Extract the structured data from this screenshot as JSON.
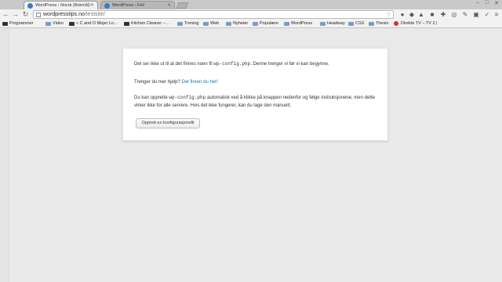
{
  "tabs": [
    {
      "title": "WordPress › Norsk (Bokmål)",
      "active": true
    },
    {
      "title": "WordPress › Feil",
      "active": false
    }
  ],
  "toolbar": {
    "url_host": "wordpresstips.no",
    "url_path": "/testsite/"
  },
  "bookmarks": [
    {
      "label": "Programmer",
      "icon": "apps-icon"
    },
    {
      "label": "Video",
      "icon": "folder-icon"
    },
    {
      "label": "« C and O Mojer Lo…",
      "icon": "page-icon"
    },
    {
      "label": "Kitchen Cleaner –…",
      "icon": "page-icon"
    },
    {
      "label": "Trening",
      "icon": "folder-icon"
    },
    {
      "label": "Web",
      "icon": "folder-icon"
    },
    {
      "label": "Nyheter",
      "icon": "folder-icon"
    },
    {
      "label": "Populære",
      "icon": "folder-icon"
    },
    {
      "label": "WordPress",
      "icon": "folder-icon"
    },
    {
      "label": "Headway",
      "icon": "folder-icon"
    },
    {
      "label": "CSS",
      "icon": "folder-icon"
    },
    {
      "label": "Thesis",
      "icon": "folder-icon"
    },
    {
      "label": "Direkte TV – TV 2 |",
      "icon": "tv2-icon"
    }
  ],
  "content": {
    "p1_before": "Det ser ikke ut til at det finnes noen fil ",
    "p1_code": "wp-config.php",
    "p1_after": ". Denne trenger vi før vi kan begynne.",
    "p2_before": "Trenger du mer hjelp? ",
    "p2_link": "Det finner du her!",
    "p3_before": "Du kan opprette ",
    "p3_code": "wp-config.php",
    "p3_after": " automatisk ved å klikke på knappen nedenfor og følge instruksjonene, men dette virker ikke for alle servere. Hvis det ikke fungerer, kan du lage den manuelt.",
    "button_label": "Opprett en konfigurasjonsfil"
  },
  "colors": {
    "link": "#21759b",
    "page_background": "#e9e9e9",
    "card_background": "#ffffff"
  }
}
